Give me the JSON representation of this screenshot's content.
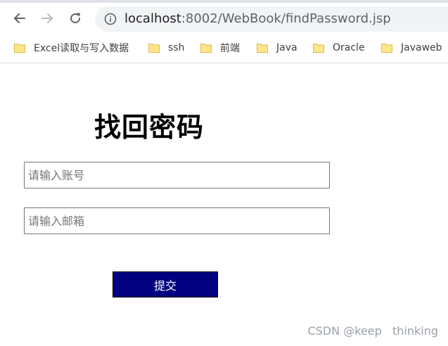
{
  "browser": {
    "url_host": "localhost",
    "url_rest": ":8002/WebBook/findPassword.jsp",
    "bookmarks": [
      {
        "label": "Excel读取与写入数据"
      },
      {
        "label": "ssh"
      },
      {
        "label": "前端"
      },
      {
        "label": "Java"
      },
      {
        "label": "Oracle"
      },
      {
        "label": "Javaweb"
      }
    ]
  },
  "page": {
    "title": "找回密码",
    "account_placeholder": "请输入账号",
    "email_placeholder": "请输入邮箱",
    "submit_label": "提交",
    "watermark": "CSDN @keep   thinking"
  },
  "colors": {
    "submit_bg": "#000080",
    "folder": "#fde68a"
  }
}
